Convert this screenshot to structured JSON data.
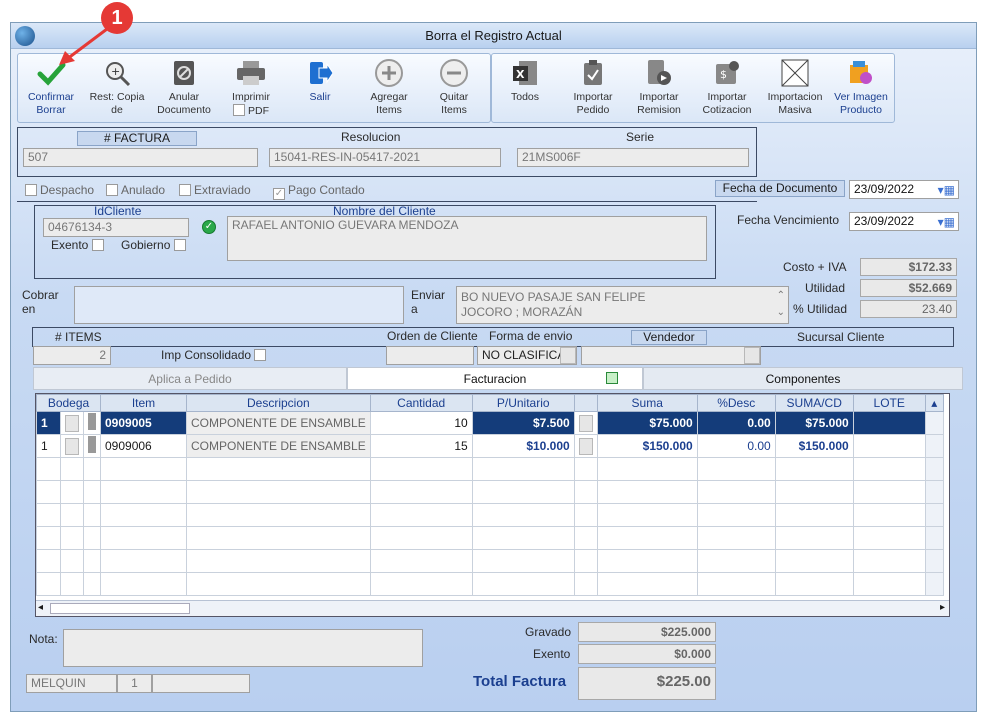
{
  "window": {
    "title": "Borra el Registro Actual",
    "callout": "1"
  },
  "toolbar": [
    {
      "id": "confirmar",
      "label1": "Confirmar",
      "label2": "Borrar",
      "icon": "check-icon"
    },
    {
      "id": "rest",
      "label1": "Rest: Copia",
      "label2": "de",
      "icon": "zoom-icon"
    },
    {
      "id": "anular",
      "label1": "Anular",
      "label2": "Documento",
      "icon": "cancel-doc-icon"
    },
    {
      "id": "imprimir",
      "label1": "Imprimir",
      "label2": "PDF",
      "icon": "printer-icon"
    },
    {
      "id": "salir",
      "label1": "Salir",
      "label2": "",
      "icon": "exit-icon"
    },
    {
      "id": "agregar",
      "label1": "Agregar",
      "label2": "Items",
      "icon": "plus-circle-icon"
    },
    {
      "id": "quitar",
      "label1": "Quitar",
      "label2": "Items",
      "icon": "minus-circle-icon"
    },
    {
      "id": "todos",
      "label1": "Todos",
      "label2": "",
      "icon": "excel-icon"
    },
    {
      "id": "imp_pedido",
      "label1": "Importar",
      "label2": "Pedido",
      "icon": "clipboard-icon"
    },
    {
      "id": "imp_remision",
      "label1": "Importar",
      "label2": "Remision",
      "icon": "remision-icon"
    },
    {
      "id": "imp_cotizacion",
      "label1": "Importar",
      "label2": "Cotizacion",
      "icon": "quote-icon"
    },
    {
      "id": "imp_masiva",
      "label1": "Importacion",
      "label2": "Masiva",
      "icon": "blank-x-icon"
    },
    {
      "id": "ver_imagen",
      "label1": "Ver Imagen",
      "label2": "Producto",
      "icon": "product-image-icon"
    }
  ],
  "header": {
    "factura_label": "# FACTURA",
    "factura": "507",
    "resolucion_label": "Resolucion",
    "resolucion": "15041-RES-IN-05417-2021",
    "serie_label": "Serie",
    "serie": "21MS006F"
  },
  "flags": {
    "despacho": "Despacho",
    "anulado": "Anulado",
    "extraviado": "Extraviado",
    "pago": "Pago Contado"
  },
  "fecha_doc_label": "Fecha de Documento",
  "fecha_doc": "23/09/2022",
  "fecha_venc_label": "Fecha Vencimiento",
  "fecha_venc": "23/09/2022",
  "cliente": {
    "id_label": "IdCliente",
    "id": "04676134-3",
    "nombre_label": "Nombre del Cliente",
    "nombre": "RAFAEL ANTONIO GUEVARA MENDOZA",
    "exento": "Exento",
    "gobierno": "Gobierno"
  },
  "totals_side": {
    "costo_label": "Costo + IVA",
    "costo": "$172.33",
    "utilidad_label": "Utilidad",
    "utilidad": "$52.669",
    "putilidad_label": "% Utilidad",
    "putilidad": "23.40"
  },
  "cobrar": {
    "l1": "Cobrar",
    "l2": "en"
  },
  "enviar": {
    "l1": "Enviar",
    "l2": "a",
    "line1": "BO NUEVO PASAJE SAN FELIPE",
    "line2": "JOCORO ; MORAZÁN"
  },
  "row2": {
    "items_label": "# ITEMS",
    "items": "2",
    "imp_consolidado": "Imp Consolidado",
    "orden_label": "Orden de Cliente",
    "forma_label": "Forma de envio",
    "forma": "NO CLASIFICA",
    "vendedor_label": "Vendedor",
    "sucursal_label": "Sucursal Cliente"
  },
  "tabs": {
    "a": "Aplica a Pedido",
    "b": "Facturacion",
    "c": "Componentes"
  },
  "grid": {
    "headers": [
      "Bodega",
      "Item",
      "Descripcion",
      "Cantidad",
      "P/Unitario",
      "Suma",
      "%Desc",
      "SUMA/CD",
      "LOTE"
    ],
    "rows": [
      {
        "bodega": "1",
        "item": "0909005",
        "desc": "COMPONENTE DE ENSAMBLE",
        "cant": "10",
        "pu": "$7.500",
        "suma": "$75.000",
        "desc_pct": "0.00",
        "sumacd": "$75.000"
      },
      {
        "bodega": "1",
        "item": "0909006",
        "desc": "COMPONENTE DE ENSAMBLE",
        "cant": "15",
        "pu": "$10.000",
        "suma": "$150.000",
        "desc_pct": "0.00",
        "sumacd": "$150.000"
      }
    ]
  },
  "footer": {
    "nota_label": "Nota:",
    "user": "MELQUIN",
    "user_num": "1",
    "gravado_label": "Gravado",
    "gravado": "$225.000",
    "exento_label": "Exento",
    "exento": "$0.000",
    "total_label": "Total Factura",
    "total": "$225.00"
  }
}
